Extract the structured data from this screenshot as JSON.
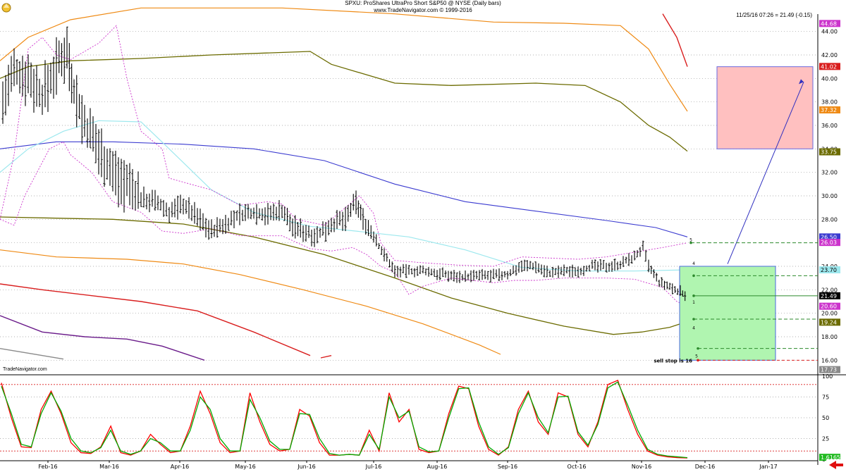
{
  "header": {
    "title": "SPXU: ProShares UltraPro Short S&P50 @ NYSE (Daily bars)",
    "subtitle": "www.TradeNavigator.com © 1999-2016",
    "quote": "11/25/16 07:26 = 21.49 (-0.15)",
    "brand": "TradeNavigator.com"
  },
  "colors": {
    "bg": "#ffffff",
    "grid": "#999999",
    "price_bar": "#000000",
    "ma_blue": "#3b3bd0",
    "ma_cyan": "#9de8ee",
    "band_olive": "#6b6b00",
    "band_orange": "#ef8a14",
    "band_red": "#d91e1e",
    "band_purple": "#6a1b8a",
    "band_gray": "#8a8a8a",
    "bollinger": "#cc33cc",
    "stoch_k": "#ff0000",
    "stoch_d": "#00aa00",
    "target_box": "#ffc0c0",
    "entry_box": "#b0f5b0"
  },
  "chart_data": [
    {
      "type": "line",
      "name": "price-panel",
      "x_ticks": [
        "Feb-16",
        "Mar-16",
        "Apr-16",
        "May-16",
        "Jun-16",
        "Jul-16",
        "Aug-16",
        "Sep-16",
        "Oct-16",
        "Nov-16",
        "Dec-16",
        "Jan-17"
      ],
      "y_ticks": [
        16.0,
        18.0,
        20.0,
        22.0,
        24.0,
        26.0,
        28.0,
        30.0,
        32.0,
        34.0,
        36.0,
        38.0,
        40.0,
        42.0,
        44.0
      ],
      "ylim": [
        15.0,
        45.0
      ],
      "grid": true,
      "ohlc_close_estimates": [
        {
          "date": "Feb-16",
          "value": 41.0
        },
        {
          "date": "Mar-16",
          "value": 34.0
        },
        {
          "date": "Apr-16",
          "value": 29.0
        },
        {
          "date": "May-16",
          "value": 28.5
        },
        {
          "date": "Jun-16",
          "value": 27.0
        },
        {
          "date": "Jul-16",
          "value": 26.0
        },
        {
          "date": "Aug-16",
          "value": 23.2
        },
        {
          "date": "Sep-16",
          "value": 23.5
        },
        {
          "date": "Oct-16",
          "value": 23.4
        },
        {
          "date": "Nov-16",
          "value": 22.8
        }
      ],
      "last_bars": {
        "date": "11/25/16",
        "close": 21.49
      },
      "price_labels": [
        {
          "text": "44.68",
          "value": 44.68,
          "color": "#cc33cc"
        },
        {
          "text": "41.02",
          "value": 41.02,
          "color": "#d91e1e"
        },
        {
          "text": "37.32",
          "value": 37.32,
          "color": "#ef8a14"
        },
        {
          "text": "33.75",
          "value": 33.75,
          "color": "#6b6b00"
        },
        {
          "text": "26.50",
          "value": 26.5,
          "color": "#3b3bd0"
        },
        {
          "text": "26.03",
          "value": 26.03,
          "color": "#cc33cc"
        },
        {
          "text": "23.70",
          "value": 23.7,
          "color": "#9de8ee"
        },
        {
          "text": "21.49",
          "value": 21.49,
          "color": "#000000"
        },
        {
          "text": "20.60",
          "value": 20.6,
          "color": "#cc33cc"
        },
        {
          "text": "19.24",
          "value": 19.24,
          "color": "#6b6b00"
        },
        {
          "text": "17.73",
          "value": 15.2,
          "color": "#8a8a8a"
        }
      ],
      "annotations": [
        {
          "text": "sell stop is 16",
          "value": 16.0
        },
        {
          "text": "1",
          "value": 21.2
        },
        {
          "text": "4",
          "value": 24.2
        },
        {
          "text": "4",
          "value": 19.0
        },
        {
          "text": "5",
          "value": 26.3
        },
        {
          "text": "5",
          "value": 16.5
        }
      ],
      "target_zone": {
        "from": 34.0,
        "to": 41.0
      },
      "entry_zone": {
        "from": 16.0,
        "to": 24.0
      }
    },
    {
      "type": "line",
      "name": "stochastic-panel",
      "y_ticks": [
        0,
        25,
        50,
        75,
        100
      ],
      "ylim": [
        0,
        100
      ],
      "levels": [
        10,
        90
      ],
      "last_value_label": "1.6165",
      "series": [
        {
          "name": "%K",
          "color": "#ff0000",
          "values": [
            92,
            50,
            15,
            14,
            60,
            82,
            55,
            20,
            8,
            7,
            15,
            40,
            8,
            5,
            10,
            30,
            18,
            8,
            10,
            40,
            82,
            55,
            20,
            8,
            10,
            80,
            45,
            18,
            10,
            12,
            60,
            52,
            20,
            5,
            5,
            6,
            5,
            35,
            10,
            80,
            45,
            60,
            12,
            8,
            10,
            55,
            88,
            85,
            40,
            12,
            5,
            15,
            60,
            82,
            45,
            30,
            80,
            75,
            30,
            15,
            45,
            90,
            95,
            60,
            30,
            10,
            5,
            3,
            2,
            1.6
          ]
        },
        {
          "name": "%D",
          "color": "#00aa00",
          "values": [
            88,
            55,
            18,
            15,
            55,
            80,
            58,
            25,
            10,
            8,
            14,
            35,
            10,
            6,
            10,
            25,
            20,
            10,
            10,
            35,
            75,
            60,
            25,
            10,
            10,
            72,
            50,
            22,
            12,
            12,
            55,
            54,
            25,
            7,
            5,
            6,
            5,
            30,
            12,
            75,
            50,
            58,
            15,
            9,
            10,
            50,
            85,
            86,
            45,
            15,
            6,
            14,
            55,
            80,
            50,
            32,
            75,
            76,
            33,
            17,
            42,
            86,
            93,
            65,
            35,
            12,
            6,
            4,
            3,
            2.0
          ]
        }
      ]
    }
  ]
}
